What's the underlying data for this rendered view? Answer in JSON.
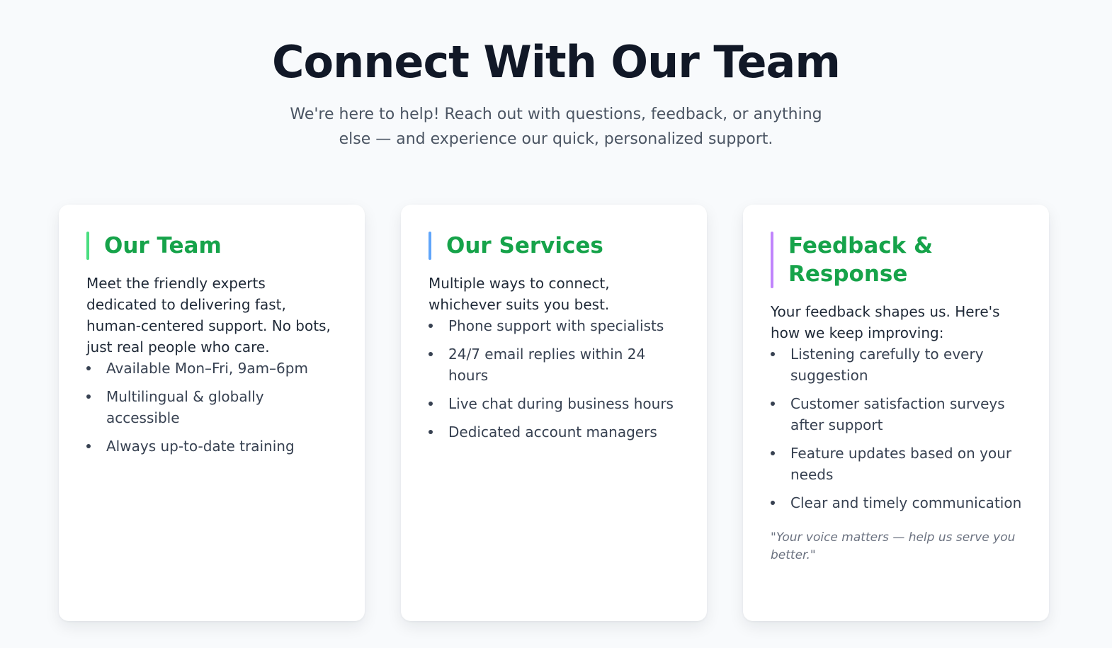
{
  "header": {
    "title": "Connect With Our Team",
    "subtitle": "We're here to help! Reach out with questions, feedback, or anything else — and experience our quick, personalized support."
  },
  "colors": {
    "title_green": "#16a34a",
    "accent_green": "#4ade80",
    "accent_blue": "#60a5fa",
    "accent_purple": "#c084fc"
  },
  "cards": [
    {
      "title": "Our Team",
      "accent_color": "#4ade80",
      "description": "Meet the friendly experts dedicated to delivering fast, human-centered support. No bots, just real people who care.",
      "items": [
        "Available Mon–Fri, 9am–6pm",
        "Multilingual & globally accessible",
        "Always up-to-date training"
      ]
    },
    {
      "title": "Our Services",
      "accent_color": "#60a5fa",
      "description": "Multiple ways to connect, whichever suits you best.",
      "items": [
        "Phone support with specialists",
        "24/7 email replies within 24 hours",
        "Live chat during business hours",
        "Dedicated account managers"
      ]
    },
    {
      "title": "Feedback & Response",
      "accent_color": "#c084fc",
      "description": "Your feedback shapes us. Here's how we keep improving:",
      "items": [
        "Listening carefully to every suggestion",
        "Customer satisfaction surveys after support",
        "Feature updates based on your needs",
        "Clear and timely communication"
      ],
      "quote": "\"Your voice matters — help us serve you better.\""
    }
  ]
}
